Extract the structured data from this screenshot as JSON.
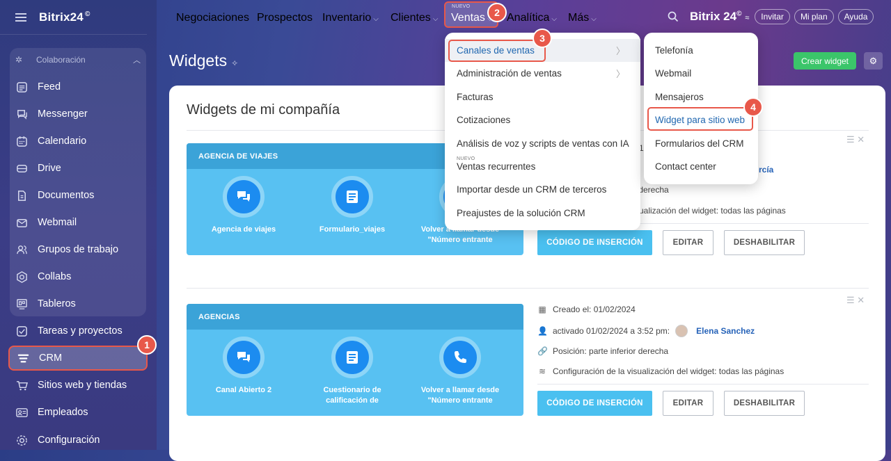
{
  "app": {
    "logo": "Bitrix24",
    "logo_mark": "©"
  },
  "sidebar": {
    "group_title": "Colaboración",
    "items": [
      {
        "label": "Feed",
        "icon": "feed-icon"
      },
      {
        "label": "Messenger",
        "icon": "messenger-icon"
      },
      {
        "label": "Calendario",
        "icon": "calendar-icon"
      },
      {
        "label": "Drive",
        "icon": "drive-icon"
      },
      {
        "label": "Documentos",
        "icon": "documents-icon"
      },
      {
        "label": "Webmail",
        "icon": "mail-icon"
      },
      {
        "label": "Grupos de trabajo",
        "icon": "groups-icon"
      },
      {
        "label": "Collabs",
        "icon": "collabs-icon"
      },
      {
        "label": "Tableros",
        "icon": "boards-icon"
      },
      {
        "label": "Tareas y proyectos",
        "icon": "tasks-icon"
      },
      {
        "label": "CRM",
        "icon": "crm-icon"
      },
      {
        "label": "Sitios web y tiendas",
        "icon": "sites-icon"
      },
      {
        "label": "Empleados",
        "icon": "employees-icon"
      },
      {
        "label": "Configuración",
        "icon": "settings-icon"
      }
    ]
  },
  "topnav": {
    "items": [
      "Negociaciones",
      "Prospectos",
      "Inventario",
      "Clientes",
      "Ventas",
      "Analítica",
      "Más"
    ],
    "nuevo": "NUEVO",
    "brand": "Bitrix 24",
    "invite": "Invitar",
    "plan": "Mi plan",
    "help": "Ayuda"
  },
  "page": {
    "title": "Widgets",
    "create_button": "Crear widget",
    "section_title": "Widgets de mi compañía"
  },
  "badges": [
    "1",
    "2",
    "3",
    "4"
  ],
  "menu_ventas": {
    "items": [
      "Canales de ventas",
      "Administración de ventas",
      "Facturas",
      "Cotizaciones",
      "Análisis de voz y scripts de ventas con IA",
      "Ventas recurrentes",
      "Importar desde un CRM de terceros",
      "Preajustes de la solución CRM"
    ],
    "nuevo": "NUEVO"
  },
  "menu_canales": {
    "items": [
      "Telefonía",
      "Webmail",
      "Mensajeros",
      "Widget para sitio web",
      "Formularios del CRM",
      "Contact center"
    ]
  },
  "widgets": [
    {
      "name": "AGENCIA DE VIAJES",
      "items": [
        "Agencia de viajes",
        "Formulario_viajes",
        "Volver a llamar desde \"Número entrante"
      ],
      "created": "",
      "activated_user": "rcía",
      "activated_prefix": "1",
      "position": "r derecha",
      "display": "sualización del widget:  todas las páginas",
      "insert": "CÓDIGO DE INSERCIÓN",
      "edit": "EDITAR",
      "disable": "DESHABILITAR"
    },
    {
      "name": "AGENCIAS",
      "items": [
        "Canal Abierto 2",
        "Cuestionario de calificación de",
        "Volver a llamar desde \"Número entrante"
      ],
      "created": "Creado el:  01/02/2024",
      "activated": "activado 01/02/2024 a 3:52 pm:",
      "activated_user": "Elena Sanchez",
      "position": "Posición:  parte inferior derecha",
      "display": "Configuración de la visualización del widget:  todas las páginas",
      "insert": "CÓDIGO DE INSERCIÓN",
      "edit": "EDITAR",
      "disable": "DESHABILITAR"
    }
  ]
}
